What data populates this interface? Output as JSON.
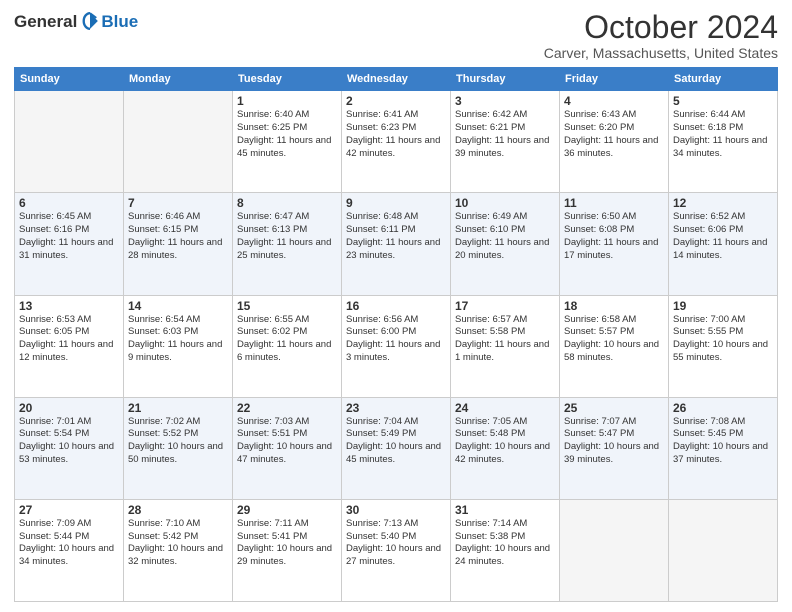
{
  "header": {
    "logo_general": "General",
    "logo_blue": "Blue",
    "month_title": "October 2024",
    "location": "Carver, Massachusetts, United States"
  },
  "days_of_week": [
    "Sunday",
    "Monday",
    "Tuesday",
    "Wednesday",
    "Thursday",
    "Friday",
    "Saturday"
  ],
  "weeks": [
    [
      {
        "day": "",
        "sunrise": "",
        "sunset": "",
        "daylight": ""
      },
      {
        "day": "",
        "sunrise": "",
        "sunset": "",
        "daylight": ""
      },
      {
        "day": "1",
        "sunrise": "Sunrise: 6:40 AM",
        "sunset": "Sunset: 6:25 PM",
        "daylight": "Daylight: 11 hours and 45 minutes."
      },
      {
        "day": "2",
        "sunrise": "Sunrise: 6:41 AM",
        "sunset": "Sunset: 6:23 PM",
        "daylight": "Daylight: 11 hours and 42 minutes."
      },
      {
        "day": "3",
        "sunrise": "Sunrise: 6:42 AM",
        "sunset": "Sunset: 6:21 PM",
        "daylight": "Daylight: 11 hours and 39 minutes."
      },
      {
        "day": "4",
        "sunrise": "Sunrise: 6:43 AM",
        "sunset": "Sunset: 6:20 PM",
        "daylight": "Daylight: 11 hours and 36 minutes."
      },
      {
        "day": "5",
        "sunrise": "Sunrise: 6:44 AM",
        "sunset": "Sunset: 6:18 PM",
        "daylight": "Daylight: 11 hours and 34 minutes."
      }
    ],
    [
      {
        "day": "6",
        "sunrise": "Sunrise: 6:45 AM",
        "sunset": "Sunset: 6:16 PM",
        "daylight": "Daylight: 11 hours and 31 minutes."
      },
      {
        "day": "7",
        "sunrise": "Sunrise: 6:46 AM",
        "sunset": "Sunset: 6:15 PM",
        "daylight": "Daylight: 11 hours and 28 minutes."
      },
      {
        "day": "8",
        "sunrise": "Sunrise: 6:47 AM",
        "sunset": "Sunset: 6:13 PM",
        "daylight": "Daylight: 11 hours and 25 minutes."
      },
      {
        "day": "9",
        "sunrise": "Sunrise: 6:48 AM",
        "sunset": "Sunset: 6:11 PM",
        "daylight": "Daylight: 11 hours and 23 minutes."
      },
      {
        "day": "10",
        "sunrise": "Sunrise: 6:49 AM",
        "sunset": "Sunset: 6:10 PM",
        "daylight": "Daylight: 11 hours and 20 minutes."
      },
      {
        "day": "11",
        "sunrise": "Sunrise: 6:50 AM",
        "sunset": "Sunset: 6:08 PM",
        "daylight": "Daylight: 11 hours and 17 minutes."
      },
      {
        "day": "12",
        "sunrise": "Sunrise: 6:52 AM",
        "sunset": "Sunset: 6:06 PM",
        "daylight": "Daylight: 11 hours and 14 minutes."
      }
    ],
    [
      {
        "day": "13",
        "sunrise": "Sunrise: 6:53 AM",
        "sunset": "Sunset: 6:05 PM",
        "daylight": "Daylight: 11 hours and 12 minutes."
      },
      {
        "day": "14",
        "sunrise": "Sunrise: 6:54 AM",
        "sunset": "Sunset: 6:03 PM",
        "daylight": "Daylight: 11 hours and 9 minutes."
      },
      {
        "day": "15",
        "sunrise": "Sunrise: 6:55 AM",
        "sunset": "Sunset: 6:02 PM",
        "daylight": "Daylight: 11 hours and 6 minutes."
      },
      {
        "day": "16",
        "sunrise": "Sunrise: 6:56 AM",
        "sunset": "Sunset: 6:00 PM",
        "daylight": "Daylight: 11 hours and 3 minutes."
      },
      {
        "day": "17",
        "sunrise": "Sunrise: 6:57 AM",
        "sunset": "Sunset: 5:58 PM",
        "daylight": "Daylight: 11 hours and 1 minute."
      },
      {
        "day": "18",
        "sunrise": "Sunrise: 6:58 AM",
        "sunset": "Sunset: 5:57 PM",
        "daylight": "Daylight: 10 hours and 58 minutes."
      },
      {
        "day": "19",
        "sunrise": "Sunrise: 7:00 AM",
        "sunset": "Sunset: 5:55 PM",
        "daylight": "Daylight: 10 hours and 55 minutes."
      }
    ],
    [
      {
        "day": "20",
        "sunrise": "Sunrise: 7:01 AM",
        "sunset": "Sunset: 5:54 PM",
        "daylight": "Daylight: 10 hours and 53 minutes."
      },
      {
        "day": "21",
        "sunrise": "Sunrise: 7:02 AM",
        "sunset": "Sunset: 5:52 PM",
        "daylight": "Daylight: 10 hours and 50 minutes."
      },
      {
        "day": "22",
        "sunrise": "Sunrise: 7:03 AM",
        "sunset": "Sunset: 5:51 PM",
        "daylight": "Daylight: 10 hours and 47 minutes."
      },
      {
        "day": "23",
        "sunrise": "Sunrise: 7:04 AM",
        "sunset": "Sunset: 5:49 PM",
        "daylight": "Daylight: 10 hours and 45 minutes."
      },
      {
        "day": "24",
        "sunrise": "Sunrise: 7:05 AM",
        "sunset": "Sunset: 5:48 PM",
        "daylight": "Daylight: 10 hours and 42 minutes."
      },
      {
        "day": "25",
        "sunrise": "Sunrise: 7:07 AM",
        "sunset": "Sunset: 5:47 PM",
        "daylight": "Daylight: 10 hours and 39 minutes."
      },
      {
        "day": "26",
        "sunrise": "Sunrise: 7:08 AM",
        "sunset": "Sunset: 5:45 PM",
        "daylight": "Daylight: 10 hours and 37 minutes."
      }
    ],
    [
      {
        "day": "27",
        "sunrise": "Sunrise: 7:09 AM",
        "sunset": "Sunset: 5:44 PM",
        "daylight": "Daylight: 10 hours and 34 minutes."
      },
      {
        "day": "28",
        "sunrise": "Sunrise: 7:10 AM",
        "sunset": "Sunset: 5:42 PM",
        "daylight": "Daylight: 10 hours and 32 minutes."
      },
      {
        "day": "29",
        "sunrise": "Sunrise: 7:11 AM",
        "sunset": "Sunset: 5:41 PM",
        "daylight": "Daylight: 10 hours and 29 minutes."
      },
      {
        "day": "30",
        "sunrise": "Sunrise: 7:13 AM",
        "sunset": "Sunset: 5:40 PM",
        "daylight": "Daylight: 10 hours and 27 minutes."
      },
      {
        "day": "31",
        "sunrise": "Sunrise: 7:14 AM",
        "sunset": "Sunset: 5:38 PM",
        "daylight": "Daylight: 10 hours and 24 minutes."
      },
      {
        "day": "",
        "sunrise": "",
        "sunset": "",
        "daylight": ""
      },
      {
        "day": "",
        "sunrise": "",
        "sunset": "",
        "daylight": ""
      }
    ]
  ]
}
